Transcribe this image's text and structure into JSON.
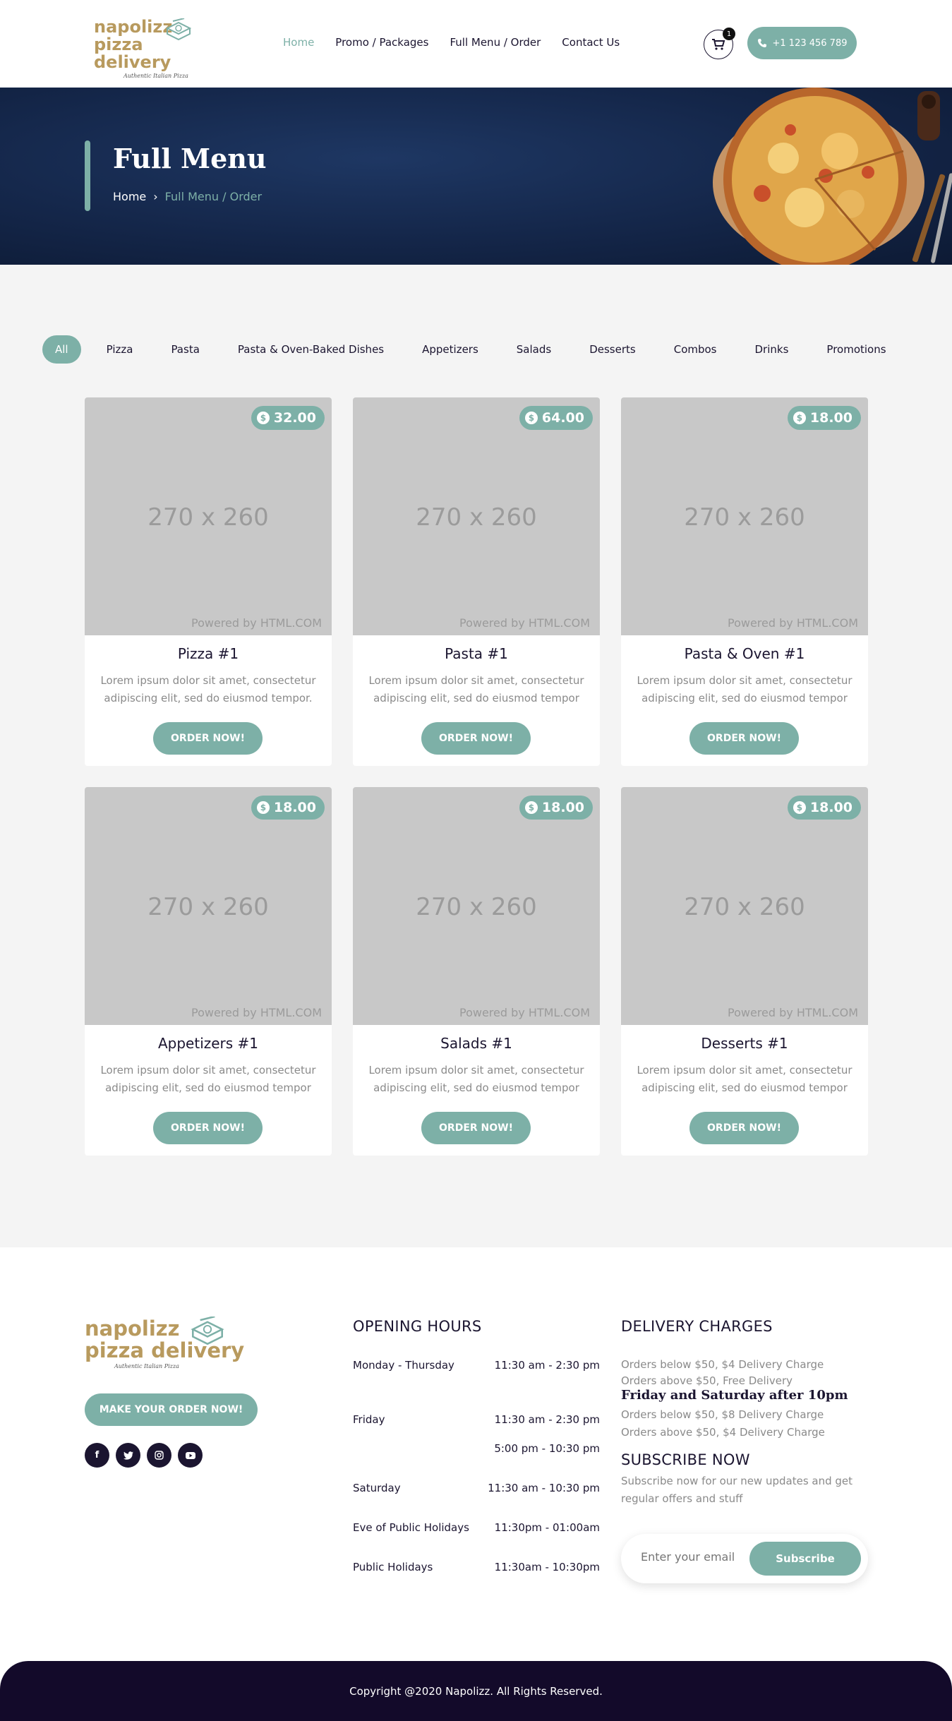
{
  "header": {
    "logo_line1": "napolizz",
    "logo_line2": "pizza delivery",
    "logo_tagline": "Authentic Italian Pizza",
    "nav": [
      "Home",
      "Promo / Packages",
      "Full Menu / Order",
      "Contact Us"
    ],
    "active_nav": "Home",
    "cart_count": "1",
    "phone": "+1 123 456 789",
    "accent_color": "#7db0a7"
  },
  "hero": {
    "title": "Full Menu",
    "breadcrumb_home": "Home",
    "breadcrumb_current": "Full Menu / Order"
  },
  "filters": {
    "tabs": [
      "All",
      "Pizza",
      "Pasta",
      "Pasta & Oven-Baked Dishes",
      "Appetizers",
      "Salads",
      "Desserts",
      "Combos",
      "Drinks",
      "Promotions"
    ],
    "active": "All"
  },
  "products": [
    {
      "price": "32.00",
      "placeholder": "270 x 260",
      "powered": "Powered by HTML.COM",
      "title": "Pizza #1",
      "desc": "Lorem ipsum dolor sit amet, consectetur adipiscing elit, sed do eiusmod tempor.",
      "button": "ORDER NOW!"
    },
    {
      "price": "64.00",
      "placeholder": "270 x 260",
      "powered": "Powered by HTML.COM",
      "title": "Pasta #1",
      "desc": "Lorem ipsum dolor sit amet, consectetur adipiscing elit, sed do eiusmod tempor",
      "button": "ORDER NOW!"
    },
    {
      "price": "18.00",
      "placeholder": "270 x 260",
      "powered": "Powered by HTML.COM",
      "title": "Pasta & Oven #1",
      "desc": "Lorem ipsum dolor sit amet, consectetur adipiscing elit, sed do eiusmod tempor",
      "button": "ORDER NOW!"
    },
    {
      "price": "18.00",
      "placeholder": "270 x 260",
      "powered": "Powered by HTML.COM",
      "title": "Appetizers #1",
      "desc": "Lorem ipsum dolor sit amet, consectetur adipiscing elit, sed do eiusmod tempor",
      "button": "ORDER NOW!"
    },
    {
      "price": "18.00",
      "placeholder": "270 x 260",
      "powered": "Powered by HTML.COM",
      "title": "Salads #1",
      "desc": "Lorem ipsum dolor sit amet, consectetur adipiscing elit, sed do eiusmod tempor",
      "button": "ORDER NOW!"
    },
    {
      "price": "18.00",
      "placeholder": "270 x 260",
      "powered": "Powered by HTML.COM",
      "title": "Desserts #1",
      "desc": "Lorem ipsum dolor sit amet, consectetur adipiscing elit, sed do eiusmod tempor",
      "button": "ORDER NOW!"
    }
  ],
  "footer": {
    "cta": "MAKE YOUR ORDER NOW!",
    "socials": [
      "facebook-icon",
      "twitter-icon",
      "instagram-icon",
      "youtube-icon"
    ],
    "hours_title": "OPENING HOURS",
    "hours": [
      {
        "day": "Monday - Thursday",
        "time": "11:30 am - 2:30 pm"
      },
      {
        "day": "Friday",
        "time": "11:30 am - 2:30 pm"
      },
      {
        "day": "",
        "time": "5:00 pm - 10:30 pm"
      },
      {
        "day": "Saturday",
        "time": "11:30 am - 10:30 pm"
      },
      {
        "day": "Eve of Public Holidays",
        "time": "11:30pm - 01:00am"
      },
      {
        "day": "Public Holidays",
        "time": "11:30am - 10:30pm"
      }
    ],
    "delivery_title": "DELIVERY CHARGES",
    "delivery_lines_1": [
      "Orders below $50, $4 Delivery Charge",
      "Orders above $50, Free Delivery"
    ],
    "delivery_subtitle": "Friday and Saturday after 10pm",
    "delivery_lines_2": [
      "Orders below $50, $8 Delivery Charge",
      "Orders above $50, $4 Delivery Charge"
    ],
    "subscribe_title": "SUBSCRIBE NOW",
    "subscribe_text": "Subscribe now for our new updates and get regular offers and stuff",
    "email_placeholder": "Enter your email",
    "subscribe_button": "Subscribe"
  },
  "copyright": "Copyright @2020 Napolizz. All Rights Reserved."
}
